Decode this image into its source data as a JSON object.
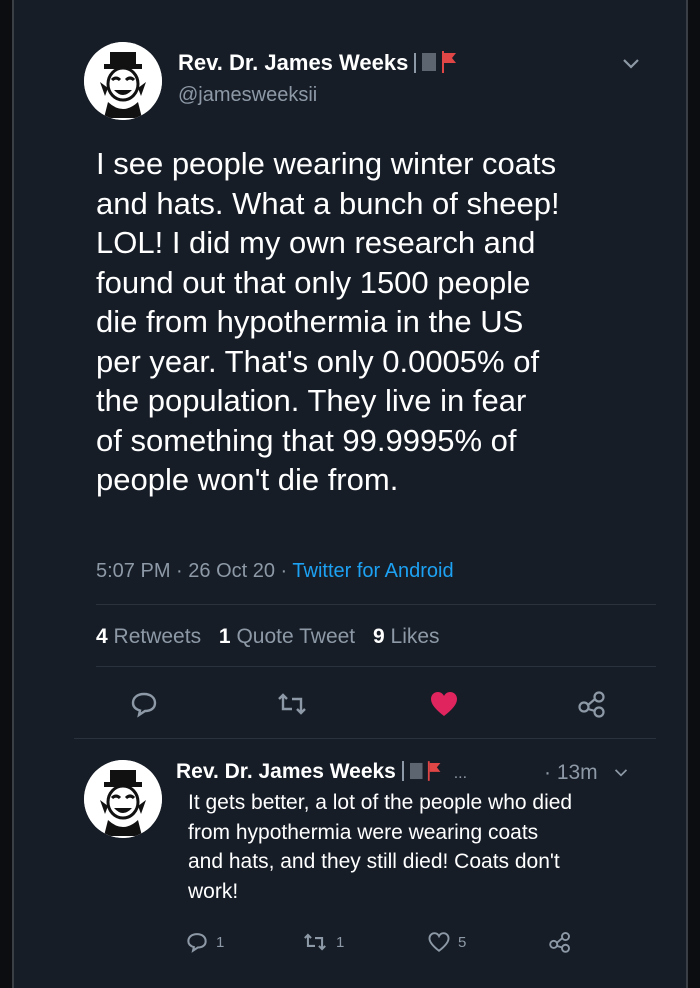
{
  "tweet": {
    "author_name": "Rev. Dr. James Weeks",
    "handle": "@jamesweeksii",
    "text_lines": [
      "I see people wearing winter coats",
      "and hats. What a bunch of sheep!",
      "LOL! I did my own research and",
      "found out that only 1500 people",
      "die from hypothermia in the US",
      "per year. That's only 0.0005% of",
      "the population. They live in fear",
      "of something that 99.9995% of",
      "people won't die from."
    ],
    "time": "5:07 PM",
    "date": "26 Oct 20",
    "source": "Twitter for Android",
    "retweets_count": "4",
    "retweets_label": "Retweets",
    "quote_count": "1",
    "quote_label": "Quote Tweet",
    "likes_count": "9",
    "likes_label": "Likes",
    "like_color": "#e0245e"
  },
  "reply": {
    "author_name": "Rev. Dr. James Weeks",
    "ellipsis": "...",
    "time_ago": "13m",
    "text_lines": [
      "It gets better, a lot of the people who died",
      "from hypothermia were wearing coats",
      "and hats, and they still died! Coats don't",
      "work!"
    ],
    "reply_count": "1",
    "retweet_count": "1",
    "like_count": "5"
  },
  "icons": [
    "chevron-down-icon",
    "reply-icon",
    "retweet-icon",
    "heart-icon",
    "share-icon",
    "flag-icon"
  ],
  "colors": {
    "background": "#161d27",
    "accent": "#1da1f2",
    "muted": "#8d99a6"
  }
}
